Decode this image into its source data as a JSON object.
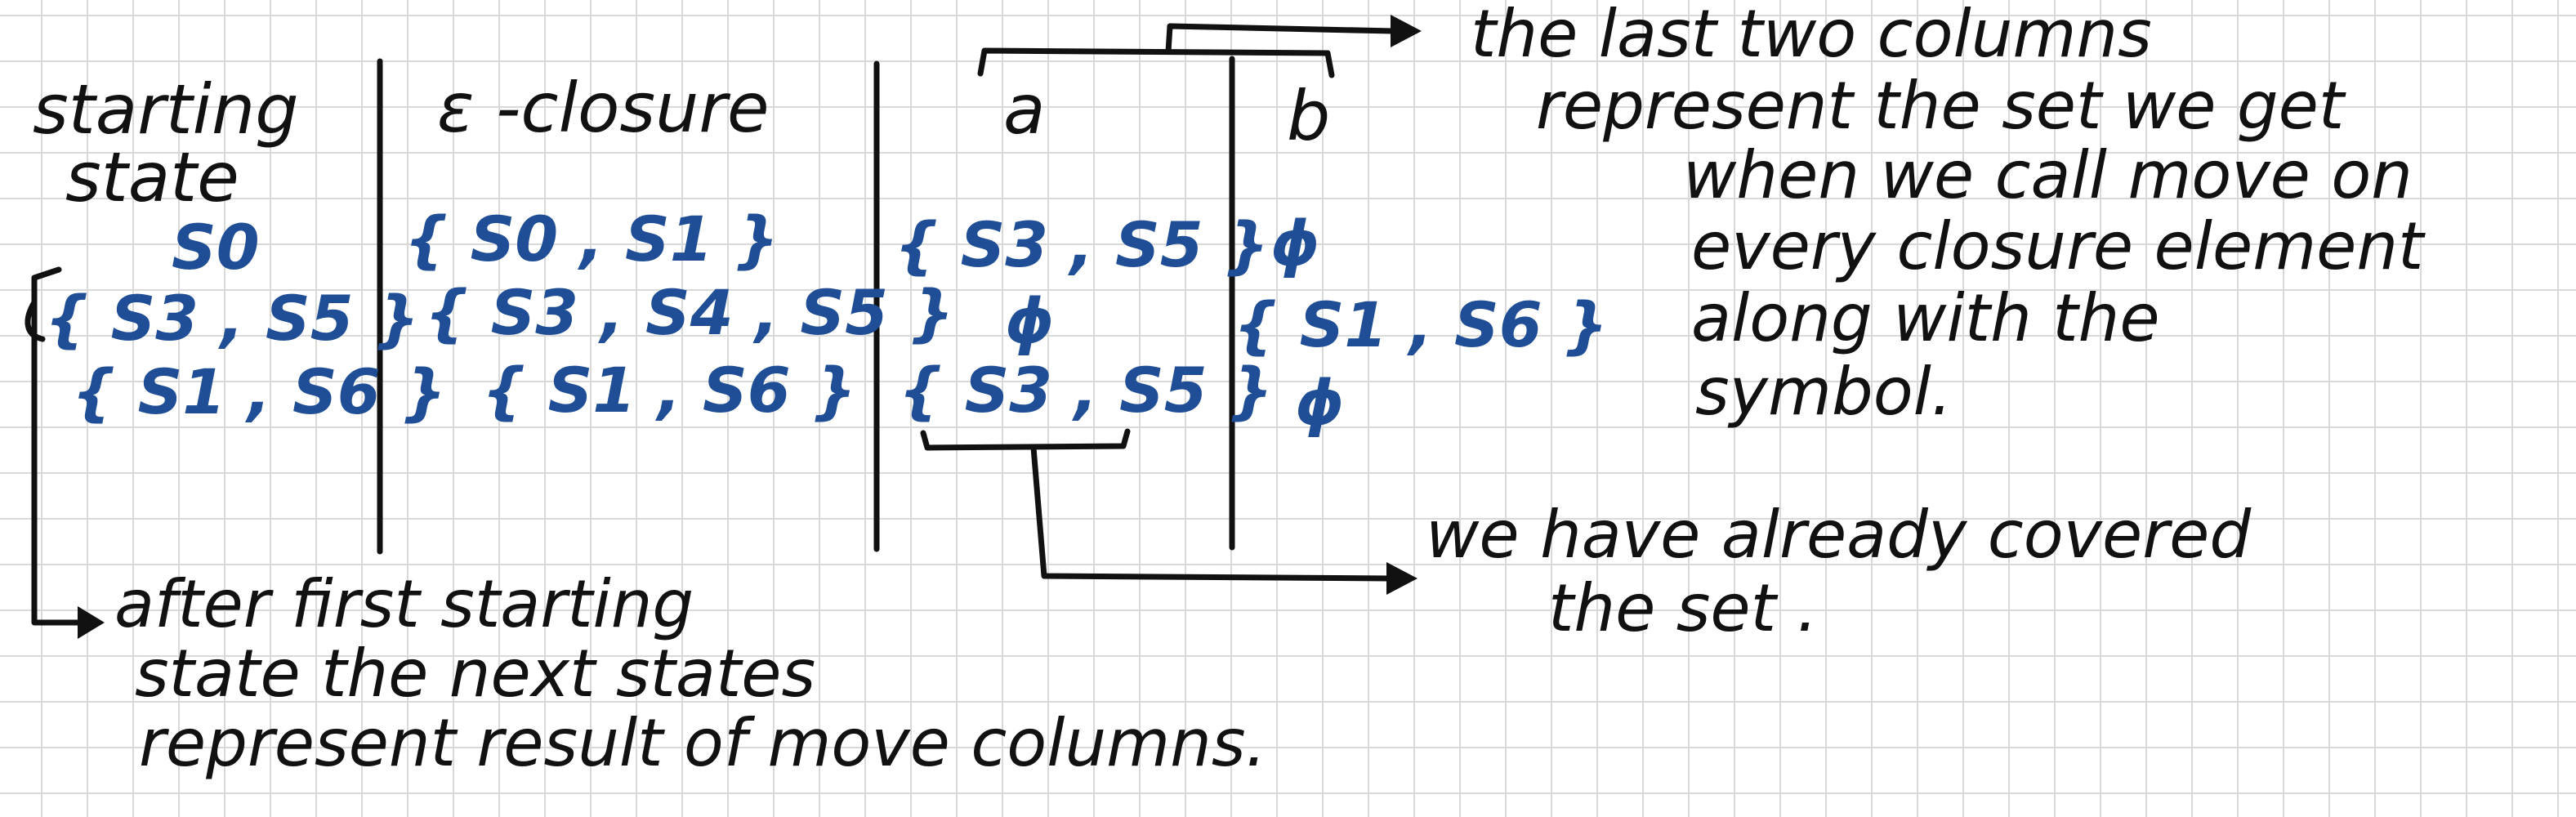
{
  "table": {
    "headers": {
      "starting_state": [
        "starting",
        "state"
      ],
      "closure": "ε -closure",
      "a": "a",
      "b": "b"
    },
    "rows": [
      {
        "start": "S0",
        "closure": "{ S0 , S1 }",
        "a": "{ S3 , S5 }",
        "b": "ϕ"
      },
      {
        "start": "{ S3 , S5 }",
        "closure": "{ S3 , S4 , S5 }",
        "a": "ϕ",
        "b": "{ S1 , S6 }"
      },
      {
        "start": "{ S1 , S6 }",
        "closure": "{ S1 , S6 }",
        "a": "{ S3 , S5 }",
        "b": "ϕ"
      }
    ]
  },
  "notes": {
    "last_columns": [
      "the last two columns",
      "represent the set we get",
      "when we call move on",
      "every closure element",
      "along with the",
      "symbol."
    ],
    "covered": [
      "we have already covered",
      "the set ."
    ],
    "after_first": [
      "after first starting",
      "state the next states",
      "represent result of move columns."
    ]
  },
  "colors": {
    "ink_black": "#111111",
    "ink_blue": "#1f4e96",
    "grid": "#d9d9d9"
  }
}
